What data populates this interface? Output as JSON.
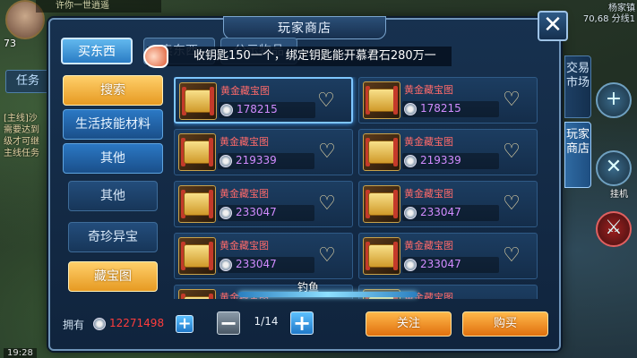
{
  "hud": {
    "player_name": "许你一世逍遥",
    "level": "73",
    "task_label": "任务",
    "quest_lines": [
      "[主线]沙",
      "需要达到",
      "级才可继",
      "主线任务"
    ],
    "location_name": "杨家镇",
    "location_coords": "70,68 分线1",
    "hangup_label": "挂机",
    "clock": "19:28"
  },
  "panel": {
    "title": "玩家商店",
    "close_label": "✕"
  },
  "top_tabs": [
    {
      "label": "买东西"
    },
    {
      "label": "卖东西"
    },
    {
      "label": "公示物品"
    }
  ],
  "ticker": {
    "text": "收钥匙150一个，绑定钥匙能开慕君石280万一"
  },
  "categories": [
    {
      "label": "搜索"
    },
    {
      "label": "生活技能材料"
    },
    {
      "label": "其他"
    },
    {
      "label": "其他"
    },
    {
      "label": "奇珍异宝"
    },
    {
      "label": "藏宝图"
    }
  ],
  "items": [
    {
      "name": "黄金藏宝图",
      "price": "178215"
    },
    {
      "name": "黄金藏宝图",
      "price": "178215"
    },
    {
      "name": "黄金藏宝图",
      "price": "219339"
    },
    {
      "name": "黄金藏宝图",
      "price": "219339"
    },
    {
      "name": "黄金藏宝图",
      "price": "233047"
    },
    {
      "name": "黄金藏宝图",
      "price": "233047"
    },
    {
      "name": "黄金藏宝图",
      "price": "233047"
    },
    {
      "name": "黄金藏宝图",
      "price": "233047"
    },
    {
      "name": "黄金藏宝图",
      "price": ""
    },
    {
      "name": "黄金藏宝图",
      "price": ""
    }
  ],
  "fishing": {
    "label": "钓鱼"
  },
  "footer": {
    "owned_label": "拥有",
    "balance": "12271498",
    "add_label": "+",
    "page_minus": "−",
    "page_plus": "+",
    "page": "1/14",
    "follow_label": "关注",
    "buy_label": "购买"
  },
  "side_tabs": [
    {
      "label": "交易市场"
    },
    {
      "label": "玩家商店"
    }
  ],
  "colors": {
    "price": "#d28cff",
    "item_name": "#ff6a6a",
    "balance": "#ff3c3c",
    "accent_gold": "#e69a22",
    "accent_blue": "#2a7cc4"
  }
}
